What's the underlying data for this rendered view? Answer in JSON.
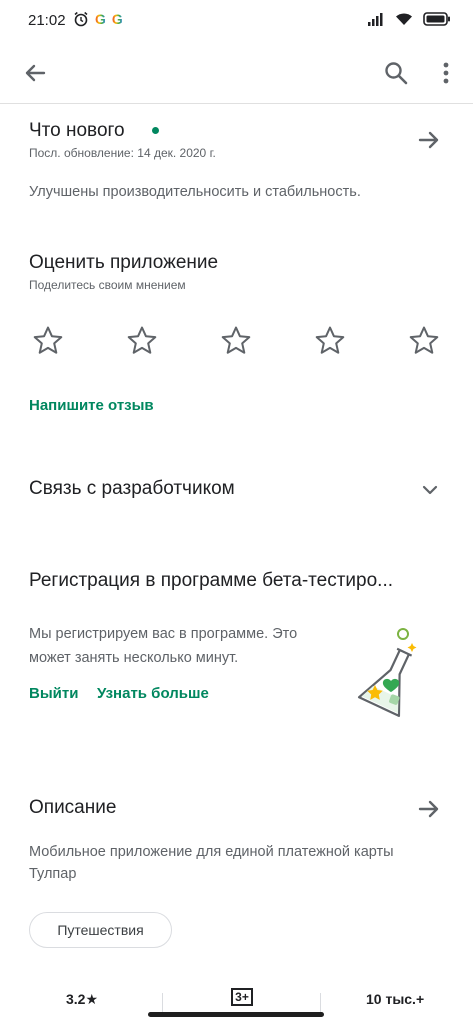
{
  "status_bar": {
    "time": "21:02",
    "icons_left": [
      "alarm-icon",
      "google-g-icon",
      "google-g-icon"
    ],
    "icons_right": [
      "signal-icon",
      "wifi-icon",
      "battery-icon"
    ]
  },
  "app_bar": {
    "icons": [
      "back-arrow-icon",
      "search-icon",
      "more-vert-icon"
    ]
  },
  "whats_new": {
    "title": "Что нового",
    "updated": "Посл. обновление: 14 дек. 2020 г.",
    "text": "Улучшены производительносить и стабильность.",
    "accent": "#01875f"
  },
  "rate": {
    "title": "Оценить приложение",
    "subtitle": "Поделитесь своим мнением",
    "stars_total": 5,
    "stars_selected": 0,
    "write_review": "Напишите отзыв"
  },
  "developer": {
    "title": "Связь с разработчиком"
  },
  "beta": {
    "title": "Регистрация в программе бета-тестиро...",
    "text_line1": "Мы регистрируем вас в программе. Это",
    "text_line2": "может занять несколько минут.",
    "leave": "Выйти",
    "learn_more": "Узнать больше"
  },
  "description": {
    "title": "Описание",
    "text_line1": "Мобильное приложение для единой платежной карты",
    "text_line2": "Тулпар",
    "tag": "Путешествия"
  },
  "stats": {
    "rating": "3.2★",
    "age": "3+",
    "installs": "10 тыс.+"
  }
}
